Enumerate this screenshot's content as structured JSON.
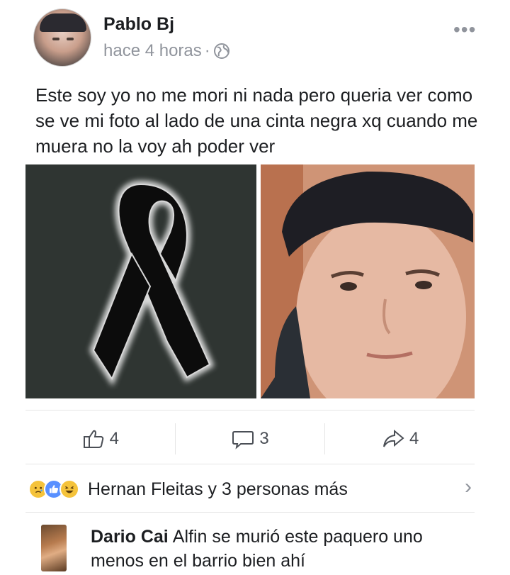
{
  "post": {
    "author": "Pablo Bj",
    "timestamp": "hace 4 horas",
    "timestamp_separator": "·",
    "text": "Este soy yo no me mori ni nada pero queria ver como se ve mi foto al lado de una cinta negra xq cuando me muera no la voy ah poder ver",
    "more_icon": "•••"
  },
  "stats": {
    "likes": "4",
    "comments": "3",
    "shares": "4"
  },
  "reactions": {
    "text": "Hernan Fleitas y 3 personas más",
    "icons": [
      "sad-icon",
      "like-icon",
      "haha-icon"
    ],
    "chevron": "›"
  },
  "comment": {
    "author": "Dario Cai",
    "text": "Alfin se murió este paquero uno menos en el barrio bien ahí"
  },
  "colors": {
    "secondary_text": "#90949c",
    "like_blue": "#5890ff",
    "reaction_yellow": "#f5c33b"
  }
}
